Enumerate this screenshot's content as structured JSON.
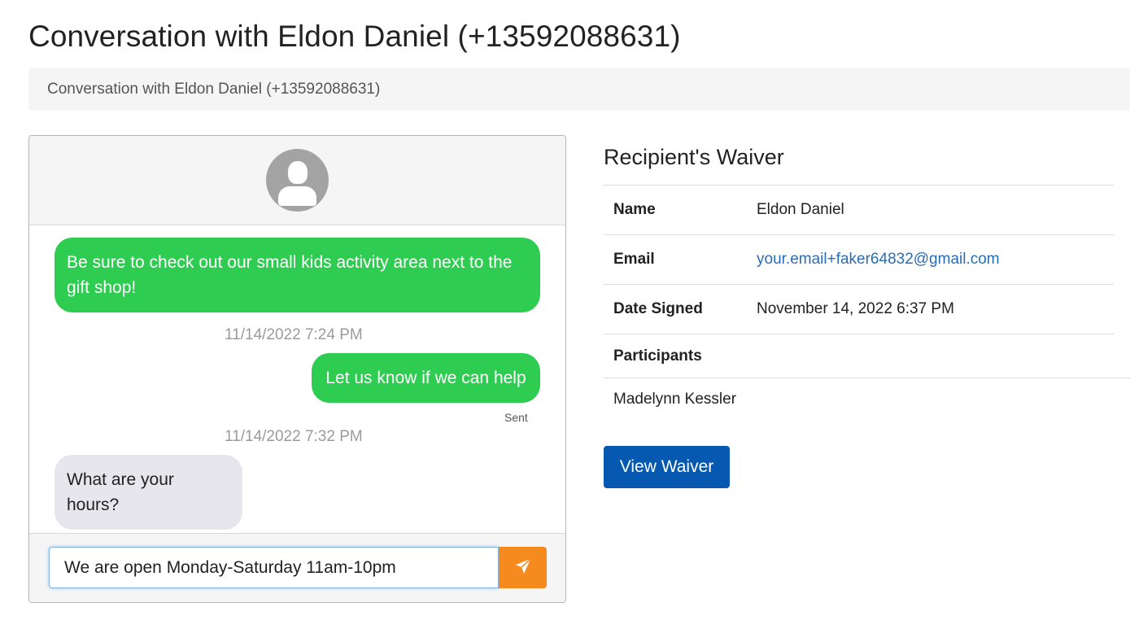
{
  "page": {
    "title": "Conversation with Eldon Daniel (+13592088631)",
    "breadcrumb": "Conversation with Eldon Daniel (+13592088631)"
  },
  "chat": {
    "avatar_icon": "user-avatar-icon",
    "messages": [
      {
        "direction": "outgoing",
        "text": "Be sure to check out our small kids activity area next to the gift shop!"
      },
      {
        "timestamp": "11/14/2022 7:24 PM"
      },
      {
        "direction": "outgoing",
        "text": "Let us know if we can help",
        "status": "Sent"
      },
      {
        "timestamp": "11/14/2022 7:32 PM"
      },
      {
        "direction": "incoming",
        "text": "What are your hours?"
      }
    ],
    "compose": {
      "value": "We are open Monday-Saturday 11am-10pm",
      "send_icon": "paper-plane-icon"
    },
    "colors": {
      "outgoing_bubble": "#2fcc52",
      "incoming_bubble": "#e6e6ec",
      "send_button": "#f58a1f"
    }
  },
  "waiver": {
    "title": "Recipient's Waiver",
    "rows": [
      {
        "label": "Name",
        "value": "Eldon Daniel"
      },
      {
        "label": "Email",
        "value": "your.email+faker64832@gmail.com"
      },
      {
        "label": "Date Signed",
        "value": "November 14, 2022 6:37 PM"
      }
    ],
    "participants_label": "Participants",
    "participants": [
      "Madelynn Kessler"
    ],
    "view_button": "View Waiver",
    "colors": {
      "link": "#2a6db5",
      "primary_button": "#0758b0"
    }
  }
}
